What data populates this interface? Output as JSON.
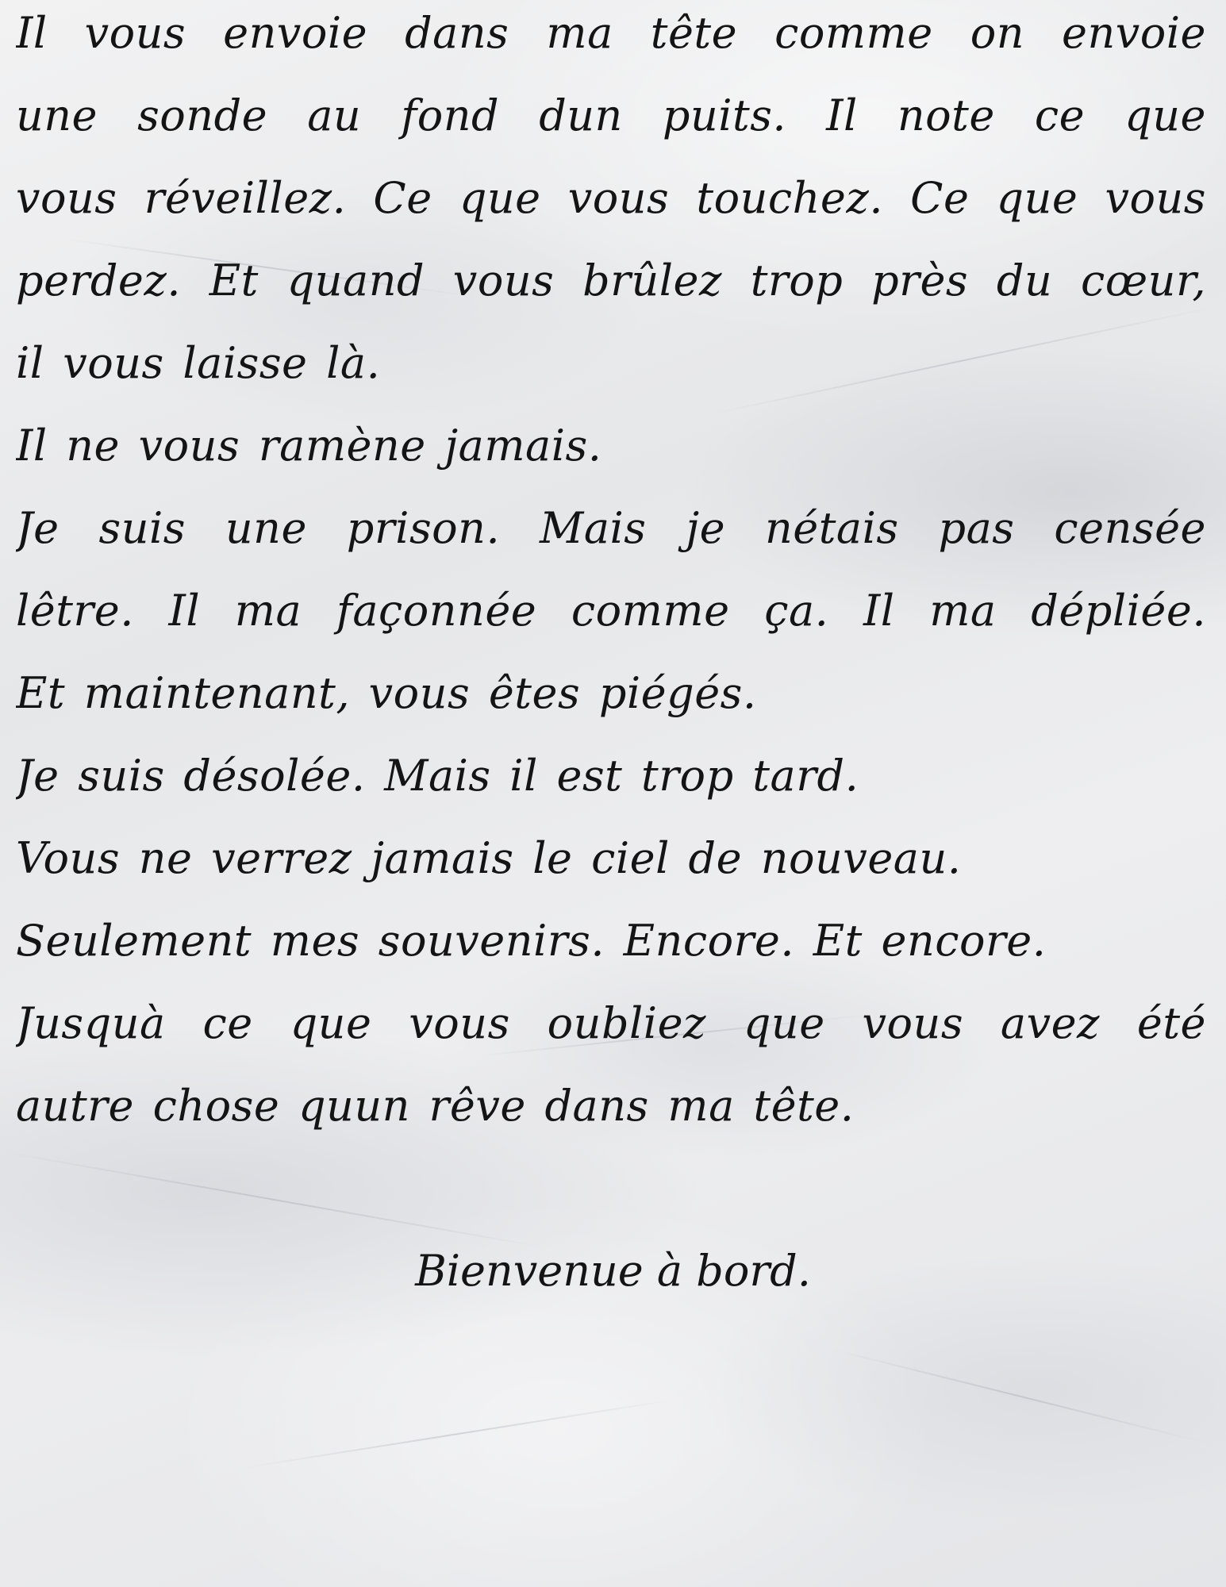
{
  "letter": {
    "lines": [
      "Il vous envoie dans ma tête comme on envoie",
      "une sonde au fond dun puits. Il note ce que",
      "vous réveillez. Ce que vous touchez. Ce que vous",
      "perdez. Et quand vous brûlez trop près du cœur,",
      "il vous laisse là.",
      "Il ne vous ramène jamais.",
      "Je suis une prison. Mais je nétais pas censée",
      "lêtre. Il ma façonnée comme ça. Il ma dépliée.",
      "Et maintenant, vous êtes piégés.",
      "Je suis désolée. Mais il est trop tard.",
      "Vous ne verrez jamais le ciel de nouveau.",
      "Seulement mes souvenirs. Encore. Et encore.",
      "Jusquà ce que vous oubliez que vous avez été",
      "autre chose quun rêve dans ma tête."
    ],
    "closing": "Bienvenue à bord."
  }
}
